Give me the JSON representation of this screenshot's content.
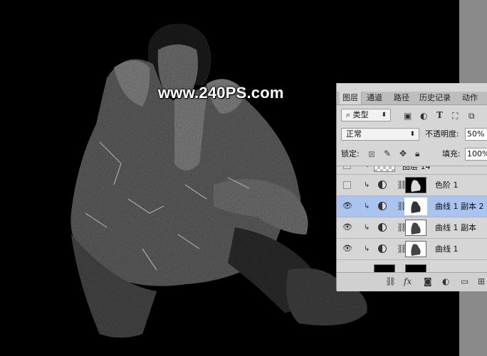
{
  "watermark": "www.240PS.com",
  "panel": {
    "tabs": [
      {
        "label": "图层",
        "active": true
      },
      {
        "label": "通道",
        "active": false
      },
      {
        "label": "路径",
        "active": false
      },
      {
        "label": "历史记录",
        "active": false
      },
      {
        "label": "动作",
        "active": false
      }
    ],
    "filter": {
      "value": "类型"
    },
    "blend_mode": "正常",
    "opacity_label": "不透明度:",
    "opacity_value": "50%",
    "lock_label": "锁定:",
    "fill_label": "填充:",
    "fill_value": "100%",
    "layers": [
      {
        "name": "图层 14",
        "visible": false,
        "selected": false,
        "type": "pixel"
      },
      {
        "name": "色阶 1",
        "visible": false,
        "selected": false,
        "type": "adjustment",
        "mask": "dark"
      },
      {
        "name": "曲线 1 副本 2",
        "visible": true,
        "selected": true,
        "type": "adjustment",
        "mask": "light"
      },
      {
        "name": "曲线 1 副本",
        "visible": true,
        "selected": false,
        "type": "adjustment",
        "mask": "light"
      },
      {
        "name": "曲线 1",
        "visible": true,
        "selected": false,
        "type": "adjustment",
        "mask": "light"
      }
    ],
    "icons": {
      "search": "search-icon",
      "image_filter": "image-filter-icon",
      "adjust_filter": "adjustment-filter-icon",
      "type_filter": "type-filter-icon",
      "shape_filter": "shape-filter-icon",
      "smart_filter": "smart-object-filter-icon"
    },
    "bottom_icons": [
      "link-icon",
      "fx-icon",
      "mask-icon",
      "adjustment-icon",
      "folder-icon",
      "new-layer-icon"
    ]
  }
}
